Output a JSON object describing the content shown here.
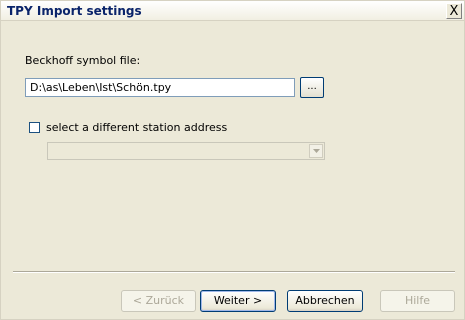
{
  "window": {
    "title": "TPY Import settings",
    "close_label": "X"
  },
  "form": {
    "file_label": "Beckhoff symbol file:",
    "file_value": "D:\\as\\Leben\\Ist\\Schön.tpy",
    "browse_label": "...",
    "station_checkbox_checked": false,
    "station_label": "select a different station address",
    "station_select_value": ""
  },
  "buttons": {
    "back": "< Zurück",
    "next": "Weiter >",
    "cancel": "Abbrechen",
    "help": "Hilfe"
  }
}
